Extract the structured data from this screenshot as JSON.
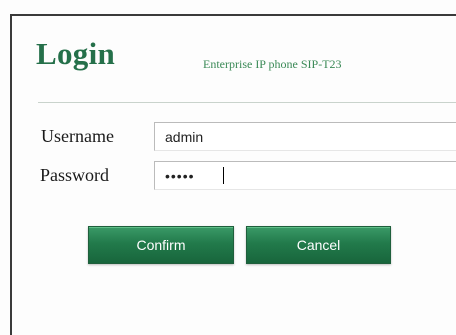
{
  "header": {
    "title": "Login",
    "device_name": "Enterprise IP phone SIP-T23"
  },
  "form": {
    "username_label": "Username",
    "username_value": "admin",
    "password_label": "Password",
    "password_value": "•••••"
  },
  "buttons": {
    "confirm_label": "Confirm",
    "cancel_label": "Cancel"
  },
  "colors": {
    "accent": "#25704a",
    "button": "#227a4b"
  }
}
